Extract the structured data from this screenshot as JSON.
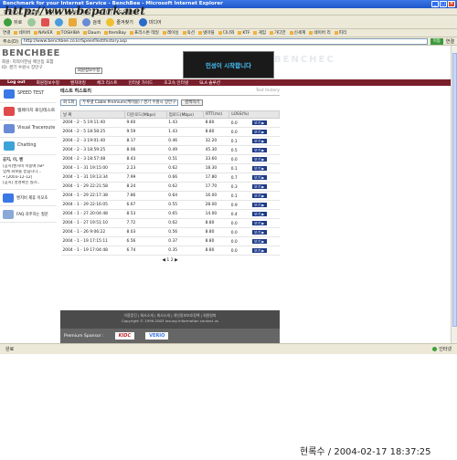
{
  "window": {
    "title": "Benchmark for your Internet Service - BenchBee - Microsoft Internet Explorer",
    "min": "_",
    "max": "□",
    "close": "×"
  },
  "menu": [
    "파일(F)",
    "편집(E)",
    "보기(V)",
    "즐겨찾기(A)",
    "도구(T)",
    "도움말(H)"
  ],
  "toolbar": {
    "back": "뒤로",
    "search": "검색",
    "favorites": "즐겨찾기",
    "media": "미디어"
  },
  "favorites": [
    "연결",
    "네이버",
    "NAVER",
    "TOSHIBA",
    "Daum",
    "ItemBay",
    "프리스톤 테일",
    "레이싱",
    "옥션",
    "넷마블",
    "디나와",
    "KTF",
    "게임",
    "가디언",
    "신세계",
    "네이버 리",
    "피리"
  ],
  "address": {
    "label": "주소(D)",
    "url": "http://www.benchbee.co.kr/SpeedTest/history.asp",
    "go": "이동",
    "links": "연결"
  },
  "header": {
    "logo": "BENCHBEE",
    "user_line1": "회원: 지적이한님 메인등 포함",
    "user_line2": "ID: 경기 수원시 장안구",
    "member_button": "회원정보수정",
    "banner": "민성이 시작합니다",
    "ghost_text": "BENCHEC"
  },
  "nav": [
    "Log out",
    "회원정보수정",
    "벤치마킹",
    "체크 리스트",
    "인터넷 가이드",
    "초고속 인터넷",
    "SLA 솔루션"
  ],
  "sidebar": {
    "items": [
      {
        "label": "SPEED TEST",
        "icon": "speedometer-icon",
        "color": "#3a78e6"
      },
      {
        "label": "웹페이지 로딩테스트",
        "icon": "globe-icon",
        "color": "#e04a4a"
      },
      {
        "label": "Visual Traceroute",
        "icon": "route-icon",
        "color": "#6a8bd6"
      },
      {
        "label": "Chatting",
        "icon": "chat-icon",
        "color": "#3ca3d8"
      }
    ],
    "notice_title": "공지, 이, 벤",
    "notices": [
      "[공지]벤치비 이용에 (SP",
      "업체 화보를 받습니다...",
      "• [2003-12-12]",
      "[공지] 성명확인 실시.."
    ],
    "extras": [
      {
        "label": "벤치비 제휴 이모조",
        "icon": "handshake-icon"
      },
      {
        "label": "FAQ 자주하는 질문",
        "icon": "question-icon"
      }
    ]
  },
  "main": {
    "title": "테스트 히스토리",
    "crumb": "Test history",
    "filter": {
      "type": "회 1회",
      "provider": "두루넷 Cable Premium(케이블) / 경기 수원시 장안구",
      "search": "검색하기"
    },
    "columns": [
      "날 짜",
      "다운로드(Mbps)",
      "업로드(Mbps)",
      "RTT(ms)",
      "LOSS(%)"
    ],
    "rows": [
      [
        "2004 - 2 - 5 19:11:40",
        "9.60",
        "1.43",
        "8.80",
        "0.0"
      ],
      [
        "2004 - 2 - 5 18:58:25",
        "9.59",
        "1.43",
        "8.80",
        "0.0"
      ],
      [
        "2004 - 2 - 3 19:01:40",
        "8.17",
        "0.46",
        "32.20",
        "0.1"
      ],
      [
        "2004 - 2 - 3 18:59:25",
        "8.06",
        "0.49",
        "45.30",
        "0.5"
      ],
      [
        "2004 - 2 - 3 18:57:48",
        "8.43",
        "0.51",
        "33.60",
        "0.0"
      ],
      [
        "2004 - 1 - 31 19:15:00",
        "2.23",
        "0.62",
        "18.30",
        "0.1"
      ],
      [
        "2004 - 1 - 31 19:13:34",
        "7.99",
        "0.66",
        "17.80",
        "0.7"
      ],
      [
        "2004 - 1 - 29 22:21:58",
        "8.24",
        "0.62",
        "17.70",
        "0.3"
      ],
      [
        "2004 - 1 - 29 22:17:38",
        "7.86",
        "0.64",
        "16.00",
        "0.1"
      ],
      [
        "2004 - 1 - 29 22:16:05",
        "6.67",
        "0.55",
        "28.00",
        "0.9"
      ],
      [
        "2004 - 1 - 27 20:04:48",
        "8.53",
        "0.65",
        "14.00",
        "0.4"
      ],
      [
        "2004 - 1 - 27 19:51:10",
        "7.72",
        "0.62",
        "8.80",
        "0.0"
      ],
      [
        "2004 - 1 - 26 9:06:22",
        "8.03",
        "0.56",
        "8.80",
        "0.0"
      ],
      [
        "2004 - 1 - 19 17:15:11",
        "6.56",
        "0.37",
        "8.80",
        "0.0"
      ],
      [
        "2004 - 1 - 19 17:04:48",
        "6.74",
        "0.35",
        "8.80",
        "0.0"
      ]
    ],
    "view_label": "보기 ▶",
    "pager": "◀ 1 2 ▶"
  },
  "footer": {
    "links": "이용증진  |  회사소개  |  회사소개  |  개인정보보호정책  |  회원탈퇴",
    "copyright": "Copyright © 1999-2003 Insung Information  contact us",
    "sponsor_label": "Premium Sponsor :",
    "sponsor1": "KIDC",
    "sponsor2": "VERIO"
  },
  "status": {
    "left": "완료",
    "right": "인터넷"
  },
  "watermark": "http://www.bcpark.net",
  "datestamp": "현록수 / 2004-02-17 18:37:25"
}
